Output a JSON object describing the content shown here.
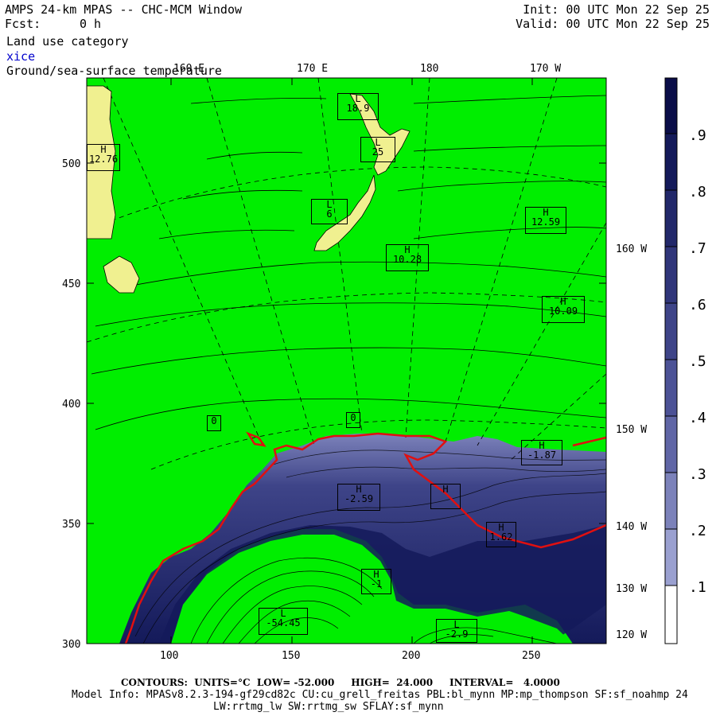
{
  "header": {
    "title": "AMPS 24-km MPAS -- CHC-MCM Window",
    "fcst_label": "Fcst:",
    "fcst_value": "0 h",
    "init": "Init: 00 UTC Mon 22 Sep 25",
    "valid": "Valid: 00 UTC Mon 22 Sep 25",
    "field1": "Land use category",
    "field2": "xice",
    "field3": "Ground/sea-surface temperature"
  },
  "colors": {
    "land_green": "#00ee00",
    "sea_ice_dark": "#141a5a",
    "sea_ice_mid": "#4c5290",
    "sea_ice_light": "#9aa0d0",
    "ice_edge_red": "#e01010",
    "terrain_yellow": "#f0f090",
    "xice_label_blue": "#0000cc"
  },
  "axes": {
    "x_ticks": [
      "100",
      "150",
      "200",
      "250"
    ],
    "y_ticks": [
      "500",
      "450",
      "400",
      "350",
      "300"
    ],
    "top_lon_labels": [
      "160 E",
      "170 E",
      "180",
      "170 W"
    ],
    "right_lon_labels": [
      "160 W",
      "150 W",
      "140 W",
      "130 W",
      "120 W"
    ]
  },
  "colorbar": {
    "labels": [
      ".9",
      ".8",
      ".7",
      ".6",
      ".5",
      ".4",
      ".3",
      ".2",
      ".1"
    ],
    "colors": [
      "#0a0d48",
      "#141a5a",
      "#22286a",
      "#30367a",
      "#3e4488",
      "#4c5296",
      "#6066a6",
      "#7c82ba",
      "#9aa0d0",
      "#ffffff"
    ]
  },
  "markers": [
    {
      "type": "L",
      "value": "18.9"
    },
    {
      "type": "L",
      "value": "25"
    },
    {
      "type": "L",
      "value": "6"
    },
    {
      "type": "H",
      "value": "12.59"
    },
    {
      "type": "H",
      "value": "10.28"
    },
    {
      "type": "H",
      "value": "10.09"
    },
    {
      "type": "H",
      "value": "12.76"
    },
    {
      "type": "H",
      "value": "-2.59"
    },
    {
      "type": "H",
      "value": "-1.87"
    },
    {
      "type": "H",
      "value": "1.62"
    },
    {
      "type": "L",
      "value": "-54.45"
    },
    {
      "type": "L",
      "value": "-2.9"
    },
    {
      "type": "H",
      "value": ""
    },
    {
      "type": "H",
      "value": "-1"
    },
    {
      "type": "",
      "value": "0"
    },
    {
      "type": "",
      "value": "0"
    }
  ],
  "footer": {
    "contours": "CONTOURS:  UNITS=°C  LOW= -52.000     HIGH=  24.000     INTERVAL=   4.0000",
    "model_info": "Model Info: MPASv8.2.3-194-gf29cd82c CU:cu_grell_freitas PBL:bl_mynn MP:mp_thompson SF:sf_noahmp 24",
    "model_info2": "LW:rrtmg_lw SW:rrtmg_sw SFLAY:sf_mynn"
  }
}
